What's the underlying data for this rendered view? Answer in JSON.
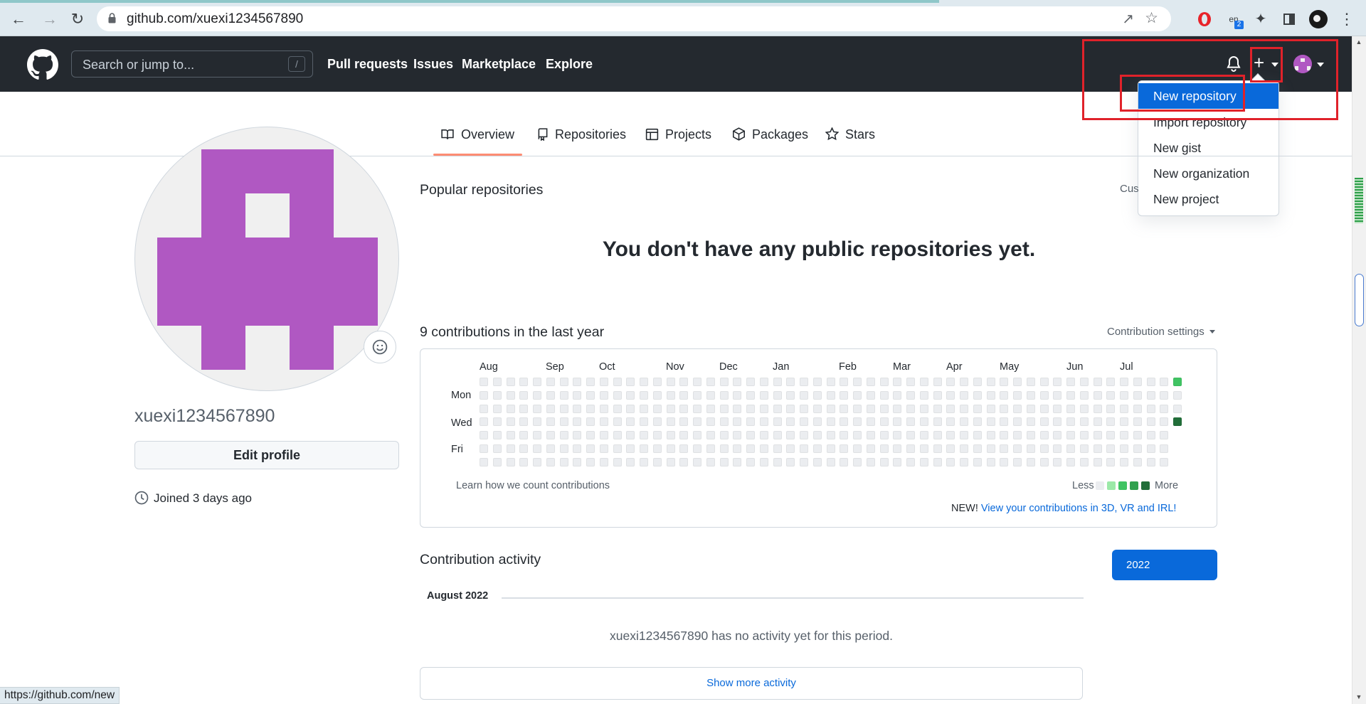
{
  "browser": {
    "url": "github.com/xuexi1234567890",
    "status_url": "https://github.com/new",
    "translate_badge": "2"
  },
  "header": {
    "search_placeholder": "Search or jump to...",
    "search_shortcut": "/",
    "nav": [
      "Pull requests",
      "Issues",
      "Marketplace",
      "Explore"
    ]
  },
  "create_menu": {
    "items": [
      "New repository",
      "Import repository",
      "New gist",
      "New organization",
      "New project"
    ],
    "selected": "New repository"
  },
  "tabs": [
    {
      "label": "Overview",
      "icon": "book-icon",
      "active": true
    },
    {
      "label": "Repositories",
      "icon": "repo-icon"
    },
    {
      "label": "Projects",
      "icon": "table-icon"
    },
    {
      "label": "Packages",
      "icon": "package-icon"
    },
    {
      "label": "Stars",
      "icon": "star-icon"
    }
  ],
  "profile": {
    "username": "xuexi1234567890",
    "edit_label": "Edit profile",
    "joined": "Joined 3 days ago",
    "avatar_color": "#b058c2"
  },
  "popular": {
    "heading": "Popular repositories",
    "customize": "Cus",
    "empty_message": "You don't have any public repositories yet."
  },
  "contributions": {
    "heading": "9 contributions in the last year",
    "settings_label": "Contribution settings",
    "months": [
      "Aug",
      "Sep",
      "Oct",
      "Nov",
      "Dec",
      "Jan",
      "Feb",
      "Mar",
      "Apr",
      "May",
      "Jun",
      "Jul"
    ],
    "days": [
      "Mon",
      "Wed",
      "Fri"
    ],
    "learn_link": "Learn how we count contributions",
    "less": "Less",
    "more": "More",
    "legend_colors": [
      "#ebedf0",
      "#9be9a8",
      "#40c463",
      "#30a14e",
      "#216e39"
    ],
    "new_prefix": "NEW!",
    "new_link": "View your contributions in 3D, VR and IRL!"
  },
  "activity": {
    "heading": "Contribution activity",
    "year": "2022",
    "month": "August 2022",
    "no_activity": "xuexi1234567890 has no activity yet for this period.",
    "show_more": "Show more activity"
  }
}
